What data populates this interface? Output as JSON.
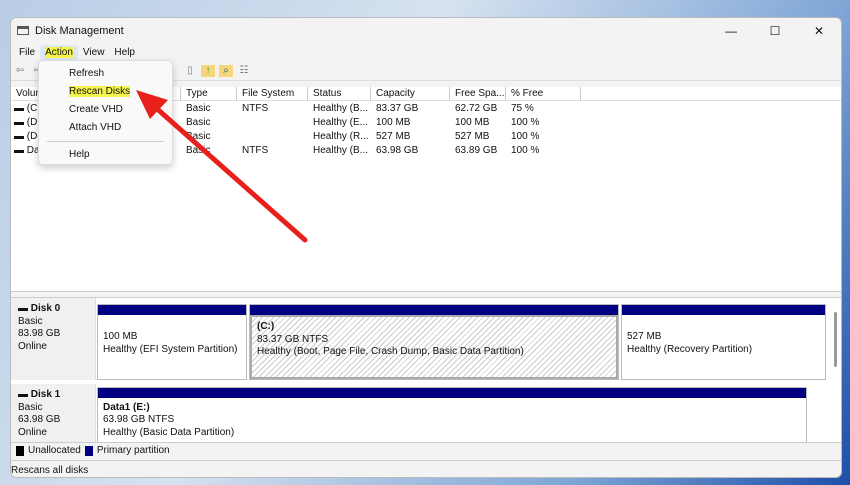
{
  "window": {
    "title": "Disk Management",
    "minimize": "—",
    "maximize": "☐",
    "close": "✕"
  },
  "menubar": [
    "File",
    "Action",
    "View",
    "Help"
  ],
  "action_menu": [
    "Refresh",
    "Rescan Disks",
    "Create VHD",
    "Attach VHD",
    "Help"
  ],
  "columns": [
    "Volume",
    "Type",
    "File System",
    "Status",
    "Capacity",
    "Free Spa...",
    "% Free"
  ],
  "volumes": [
    {
      "name": "(C:)",
      "type": "Basic",
      "fs": "NTFS",
      "status": "Healthy (B...",
      "capacity": "83.37 GB",
      "free": "62.72 GB",
      "pct": "75 %"
    },
    {
      "name": "(Disk 0 partition 1)",
      "type": "Basic",
      "fs": "",
      "status": "Healthy (E...",
      "capacity": "100 MB",
      "free": "100 MB",
      "pct": "100 %"
    },
    {
      "name": "(Disk 0 partition 4)",
      "type": "Basic",
      "fs": "",
      "status": "Healthy (R...",
      "capacity": "527 MB",
      "free": "527 MB",
      "pct": "100 %"
    },
    {
      "name": "Data1 (E:)",
      "type": "Basic",
      "fs": "NTFS",
      "status": "Healthy (B...",
      "capacity": "63.98 GB",
      "free": "63.89 GB",
      "pct": "100 %"
    }
  ],
  "disks": [
    {
      "name": "Disk 0",
      "type": "Basic",
      "size": "83.98 GB",
      "state": "Online",
      "partitions": [
        {
          "label": "",
          "size": "100 MB",
          "status": "Healthy (EFI System Partition)"
        },
        {
          "label": "(C:)",
          "size": "83.37 GB NTFS",
          "status": "Healthy (Boot, Page File, Crash Dump, Basic Data Partition)"
        },
        {
          "label": "",
          "size": "527 MB",
          "status": "Healthy (Recovery Partition)"
        }
      ]
    },
    {
      "name": "Disk 1",
      "type": "Basic",
      "size": "63.98 GB",
      "state": "Online",
      "partitions": [
        {
          "label": "Data1  (E:)",
          "size": "63.98 GB NTFS",
          "status": "Healthy (Basic Data Partition)"
        }
      ]
    }
  ],
  "legend": [
    "Unallocated",
    "Primary partition"
  ],
  "colors": {
    "unallocated": "#000000",
    "primary": "#000080",
    "arrow": "#e8201c"
  },
  "status": "Rescans all disks"
}
